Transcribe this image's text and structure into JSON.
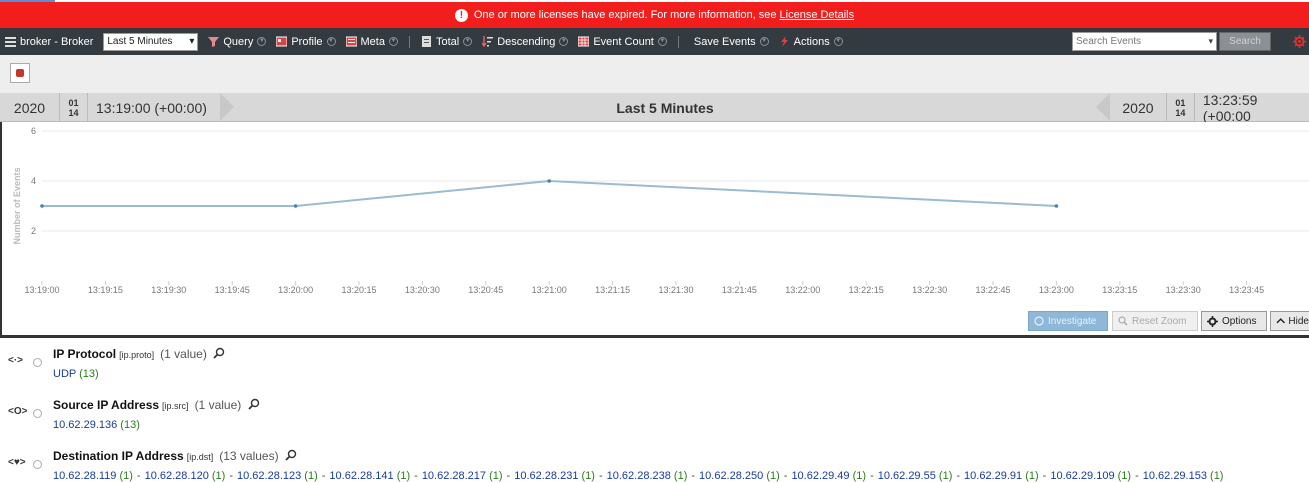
{
  "alert": {
    "message": "One or more licenses have expired. For more information, see",
    "link": "License Details"
  },
  "toolbar": {
    "device": "broker - Broker",
    "time_range": "Last 5 Minutes",
    "query": "Query",
    "profile": "Profile",
    "meta": "Meta",
    "total": "Total",
    "descending": "Descending",
    "event_count": "Event Count",
    "save_events": "Save Events",
    "actions": "Actions",
    "search_placeholder": "Search Events",
    "search_button": "Search"
  },
  "range": {
    "start_year": "2020",
    "start_month": "01",
    "start_day": "14",
    "start_time": "13:19:00 (+00:00)",
    "label": "Last 5 Minutes",
    "end_year": "2020",
    "end_month": "01",
    "end_day": "14",
    "end_time": "13:23:59 (+00:00"
  },
  "chart_data": {
    "type": "line",
    "ylabel": "Number of Events",
    "xlabel": "",
    "ylim": [
      0,
      6
    ],
    "yticks": [
      2,
      4,
      6
    ],
    "xticks": [
      "13:19:00",
      "13:19:15",
      "13:19:30",
      "13:19:45",
      "13:20:00",
      "13:20:15",
      "13:20:30",
      "13:20:45",
      "13:21:00",
      "13:21:15",
      "13:21:30",
      "13:21:45",
      "13:22:00",
      "13:22:15",
      "13:22:30",
      "13:22:45",
      "13:23:00",
      "13:23:15",
      "13:23:30",
      "13:23:45"
    ],
    "series": [
      {
        "x": [
          "13:19:00",
          "13:20:00",
          "13:21:00",
          "13:23:00"
        ],
        "values": [
          3,
          3,
          4,
          3
        ],
        "color": "#9bbbd0"
      }
    ],
    "grid": true
  },
  "chart_buttons": {
    "investigate": "Investigate",
    "reset_zoom": "Reset Zoom",
    "options": "Options",
    "hide": "Hide"
  },
  "meta": {
    "protocol": {
      "title": "IP Protocol",
      "key": "[ip.proto]",
      "count": "(1 value)",
      "values": [
        {
          "v": "UDP",
          "c": "(13)"
        }
      ]
    },
    "src": {
      "title": "Source IP Address",
      "key": "[ip.src]",
      "count": "(1 value)",
      "values": [
        {
          "v": "10.62.29.136",
          "c": "(13)"
        }
      ]
    },
    "dst": {
      "title": "Destination IP Address",
      "key": "[ip.dst]",
      "count": "(13 values)",
      "values": [
        {
          "v": "10.62.28.119",
          "c": "(1)"
        },
        {
          "v": "10.62.28.120",
          "c": "(1)"
        },
        {
          "v": "10.62.28.123",
          "c": "(1)"
        },
        {
          "v": "10.62.28.141",
          "c": "(1)"
        },
        {
          "v": "10.62.28.217",
          "c": "(1)"
        },
        {
          "v": "10.62.28.231",
          "c": "(1)"
        },
        {
          "v": "10.62.28.238",
          "c": "(1)"
        },
        {
          "v": "10.62.28.250",
          "c": "(1)"
        },
        {
          "v": "10.62.29.49",
          "c": "(1)"
        },
        {
          "v": "10.62.29.55",
          "c": "(1)"
        },
        {
          "v": "10.62.29.91",
          "c": "(1)"
        },
        {
          "v": "10.62.29.109",
          "c": "(1)"
        },
        {
          "v": "10.62.29.153",
          "c": "(1)"
        }
      ]
    }
  }
}
